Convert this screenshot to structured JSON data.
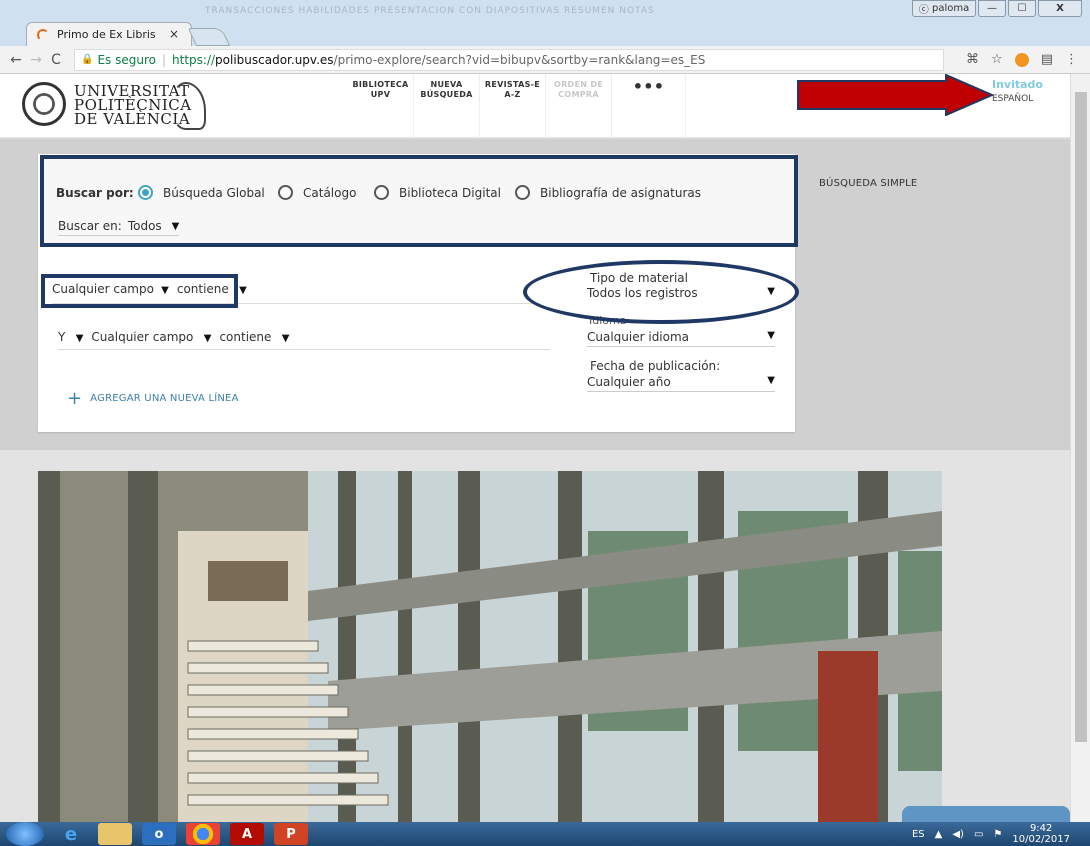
{
  "browser": {
    "tab_title": "Primo de Ex Libris",
    "tab_close": "×",
    "profile_name": "paloma",
    "blurred_bookmarks": "TRANSACCIONES   HABILIDADES   PRESENTACION CON DIAPOSITIVAS   RESUMEN   NOTAS",
    "back": "←",
    "forward": "→",
    "reload": "C",
    "secure_label": "Es seguro",
    "url_scheme": "https://",
    "url_host": "polibuscador.upv.es",
    "url_path": "/primo-explore/search?vid=bibupv&sortby=rank&lang=es_ES",
    "min": "—",
    "max": "☐",
    "close": "X"
  },
  "header": {
    "logo_lines": [
      "UNIVERSITAT",
      "POLITÈCNICA",
      "DE VALÈNCIA"
    ],
    "nav": [
      {
        "line1": "BIBLIOTECA",
        "line2": "UPV"
      },
      {
        "line1": "NUEVA",
        "line2": "BÚSQUEDA"
      },
      {
        "line1": "REVISTAS-E",
        "line2": "A-Z"
      },
      {
        "line1": "ORDEN DE",
        "line2": "COMPRA"
      }
    ],
    "more": "•••",
    "guest": "Invitado",
    "language": "ESPAÑOL"
  },
  "search": {
    "buscar_por_label": "Buscar por:",
    "scopes": [
      "Búsqueda Global",
      "Catálogo",
      "Biblioteca Digital",
      "Bibliografía de asignaturas"
    ],
    "selected_scope": "Búsqueda Global",
    "buscar_en_label": "Buscar en:",
    "buscar_en_value": "Todos",
    "simple_link": "BÚSQUEDA SIMPLE",
    "row1_field": "Cualquier campo",
    "row1_op": "contiene",
    "row2_bool": "Y",
    "row2_field": "Cualquier campo",
    "row2_op": "contiene",
    "add_line": "AGREGAR UNA NUEVA LÍNEA",
    "tipo_label": "Tipo de material",
    "tipo_value": "Todos los registros",
    "idioma_label": "Idioma",
    "idioma_value": "Cualquier idioma",
    "fecha_label": "Fecha de publicación:",
    "fecha_value": "Cualquier año"
  },
  "taskbar": {
    "lang": "ES",
    "time": "9:42",
    "date": "10/02/2017"
  },
  "colors": {
    "annotation": "#1f3864",
    "arrow": "#c00000",
    "accent": "#41a3c4"
  }
}
